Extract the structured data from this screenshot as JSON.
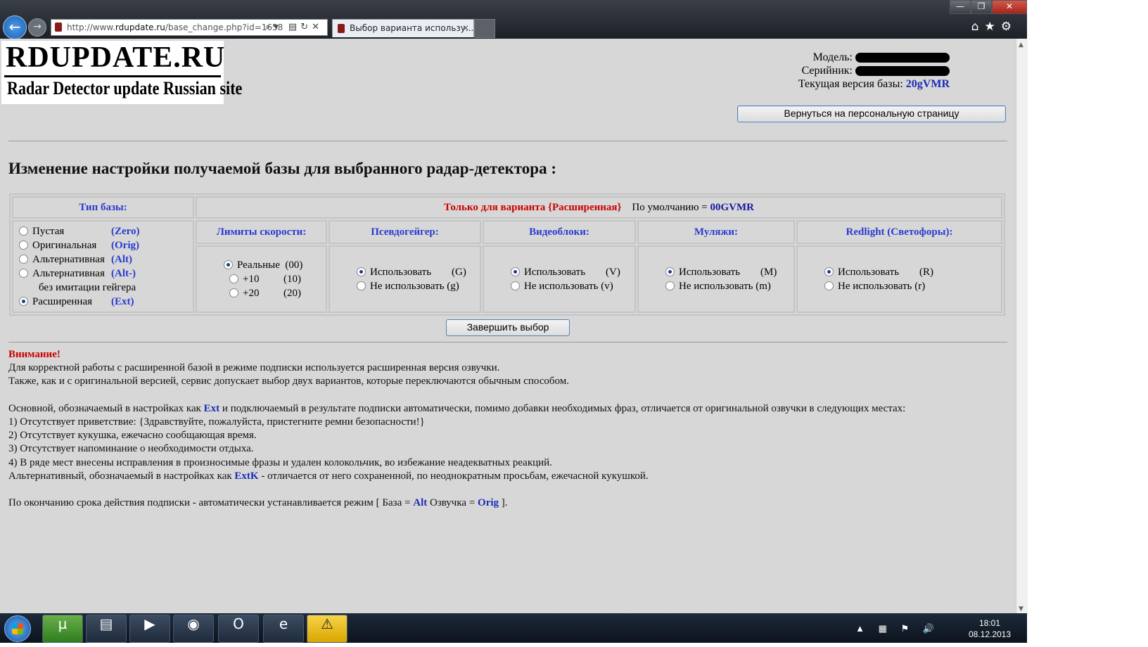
{
  "browser": {
    "url_prefix": "http://www.",
    "url_domain": "rdupdate.ru",
    "url_path": "/base_change.php?id=1658",
    "addr_tools": "⌕▾ ▤↻✕",
    "tab_title": "Выбор варианта использу...",
    "tab_close": "✕",
    "back_glyph": "←",
    "fwd_glyph": "→",
    "toolbar_icons": "⌂★⚙",
    "win_min": "—",
    "win_max": "❐",
    "win_close": "✕"
  },
  "logo": {
    "line1": "RDUPDATE.RU",
    "line2": "Radar Detector update Russian site"
  },
  "info": {
    "model_label": "Модель:",
    "serial_label": "Серийник:",
    "version_label": "Текущая версия базы:",
    "version_value": "20gVMR"
  },
  "back_button": "Вернуться на персональную страницу",
  "heading": "Изменение настройки получаемой базы для выбранного радар-детектора :",
  "table": {
    "type_header": "Тип базы:",
    "ext_only": "Только для варианта {Расширенная}",
    "default_label": "По умолчанию =",
    "default_value": "00GVMR",
    "types": [
      {
        "label": "Пустая",
        "code": "(Zero)",
        "checked": false
      },
      {
        "label": "Оригинальная",
        "code": "(Orig)",
        "checked": false
      },
      {
        "label": "Альтернативная",
        "code": "(Alt)",
        "checked": false
      },
      {
        "label": "Альтернативная",
        "code": "(Alt-)",
        "checked": false,
        "sub": "без имитации гейгера"
      },
      {
        "label": "Расширенная",
        "code": "(Ext)",
        "checked": true
      }
    ],
    "speed": {
      "header": "Лимиты скорости:",
      "options": [
        {
          "label": "Реальные",
          "code": "(00)",
          "checked": true
        },
        {
          "label": "+10",
          "code": "(10)",
          "checked": false
        },
        {
          "label": "+20",
          "code": "(20)",
          "checked": false
        }
      ]
    },
    "geiger": {
      "header": "Псевдогейгер:",
      "options": [
        {
          "label": "Использовать",
          "code": "(G)",
          "checked": true
        },
        {
          "label": "Не использовать",
          "code": "(g)",
          "checked": false
        }
      ]
    },
    "video": {
      "header": "Видеоблоки:",
      "options": [
        {
          "label": "Использовать",
          "code": "(V)",
          "checked": true
        },
        {
          "label": "Не использовать",
          "code": "(v)",
          "checked": false
        }
      ]
    },
    "dummies": {
      "header": "Муляжи:",
      "options": [
        {
          "label": "Использовать",
          "code": "(M)",
          "checked": true
        },
        {
          "label": "Не использовать",
          "code": "(m)",
          "checked": false
        }
      ]
    },
    "redlight": {
      "header": "Redlight (Светофоры):",
      "options": [
        {
          "label": "Использовать",
          "code": "(R)",
          "checked": true
        },
        {
          "label": "Не использовать",
          "code": "(r)",
          "checked": false
        }
      ]
    }
  },
  "finish_button": "Завершить выбор",
  "notes": {
    "warning": "Внимание!",
    "p1": "Для корректной работы с расширенной базой в режиме подписки используется расширенная версия озвучки.",
    "p2": "Также, как и с оригинальной версией, сервис допускает выбор двух вариантов, которые переключаются обычным способом.",
    "p3_a": "Основной, обозначаемый в настройках как ",
    "p3_k": "Ext",
    "p3_b": " и подключаемый в результате подписки автоматически, помимо добавки необходимых фраз, отличается от оригинальной озвучки в следующих местах:",
    "l1": "1) Отсутствует приветствие: {Здравствуйте, пожалуйста, пристегните ремни безопасности!}",
    "l2": "2) Отсутствует кукушка, ежечасно сообщающая время.",
    "l3": "3) Отсутствует напоминание о необходимости отдыха.",
    "l4": "4) В ряде мест внесены исправления в произносимые фразы и удален колокольчик, во избежание неадекватных реакций.",
    "p4_a": "Альтернативный, обозначаемый в настройках как ",
    "p4_k": "ExtK",
    "p4_b": " - отличается от него сохраненной, по неоднократным просьбам, ежечасной кукушкой.",
    "p5_a": "По окончанию срока действия подписки - автоматически устанавливается режим [ База = ",
    "p5_k1": "Alt",
    "p5_b": " Озвучка = ",
    "p5_k2": "Orig",
    "p5_c": " ]."
  },
  "taskbar": {
    "apps": [
      "utorrent",
      "explorer",
      "media-player",
      "firefox",
      "opera",
      "internet-explorer",
      "warning"
    ],
    "tray_icons": "▲ ▦ ⚑ 🔊",
    "time": "18:01",
    "date": "08.12.2013"
  }
}
